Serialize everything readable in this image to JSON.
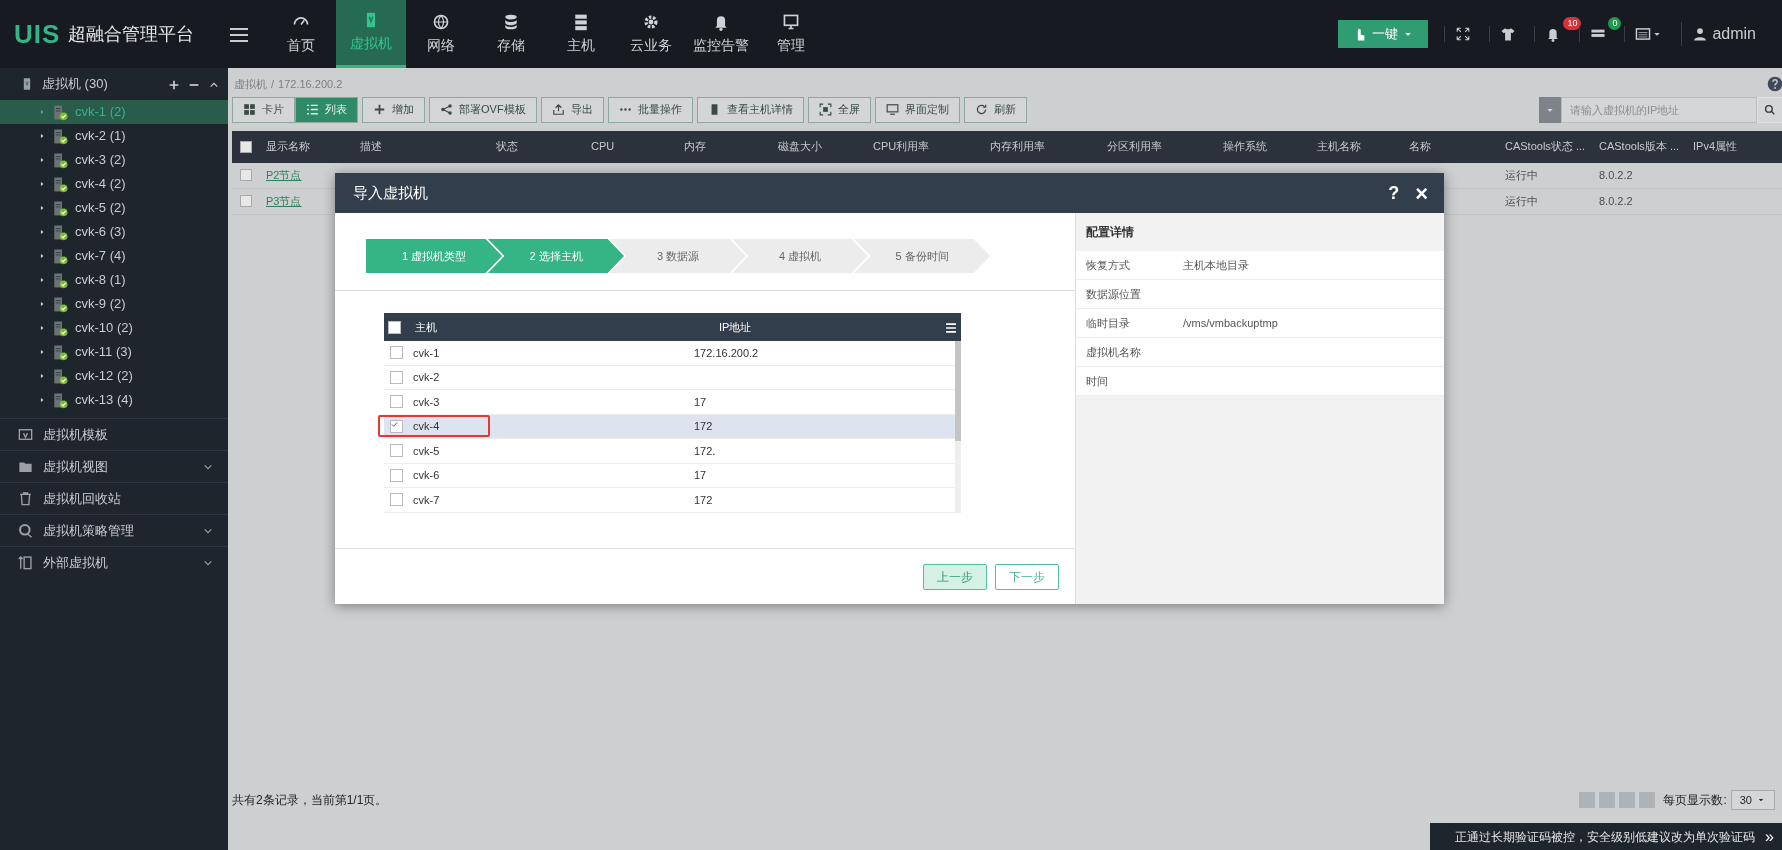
{
  "app": {
    "logo": "UIS",
    "title": "超融合管理平台"
  },
  "nav": [
    {
      "label": "首页",
      "selected": false
    },
    {
      "label": "虚拟机",
      "selected": true
    },
    {
      "label": "网络",
      "selected": false
    },
    {
      "label": "存储",
      "selected": false
    },
    {
      "label": "主机",
      "selected": false
    },
    {
      "label": "云业务",
      "selected": false
    },
    {
      "label": "监控告警",
      "selected": false
    },
    {
      "label": "管理",
      "selected": false
    }
  ],
  "topbar": {
    "quick_button": "一键",
    "alerts_count": "10",
    "tasks_count": "0",
    "user": "admin"
  },
  "sidebar": {
    "header": "虚拟机 (30)",
    "hosts": [
      {
        "label": "cvk-1 (2)",
        "selected": true
      },
      {
        "label": "cvk-2 (1)",
        "selected": false
      },
      {
        "label": "cvk-3 (2)",
        "selected": false
      },
      {
        "label": "cvk-4 (2)",
        "selected": false
      },
      {
        "label": "cvk-5 (2)",
        "selected": false
      },
      {
        "label": "cvk-6 (3)",
        "selected": false
      },
      {
        "label": "cvk-7 (4)",
        "selected": false
      },
      {
        "label": "cvk-8 (1)",
        "selected": false
      },
      {
        "label": "cvk-9 (2)",
        "selected": false
      },
      {
        "label": "cvk-10 (2)",
        "selected": false
      },
      {
        "label": "cvk-11 (3)",
        "selected": false
      },
      {
        "label": "cvk-12 (2)",
        "selected": false
      },
      {
        "label": "cvk-13 (4)",
        "selected": false
      }
    ],
    "sections": [
      {
        "label": "虚拟机模板",
        "expandable": false
      },
      {
        "label": "虚拟机视图",
        "expandable": true
      },
      {
        "label": "虚拟机回收站",
        "expandable": false
      },
      {
        "label": "虚拟机策略管理",
        "expandable": true
      },
      {
        "label": "外部虚拟机",
        "expandable": true
      }
    ]
  },
  "breadcrumb": {
    "items": [
      "虚拟机",
      "172.16.200.2"
    ],
    "separator": "/"
  },
  "view_toggle": [
    {
      "label": "卡片",
      "selected": false
    },
    {
      "label": "列表",
      "selected": true
    }
  ],
  "toolbar": [
    "增加",
    "部署OVF模板",
    "导出",
    "批量操作",
    "查看主机详情",
    "全屏",
    "界面定制",
    "刷新"
  ],
  "search": {
    "placeholder": "请输入虚拟机的IP地址"
  },
  "table": {
    "all_checked": false,
    "columns": [
      "显示名称",
      "描述",
      "状态",
      "CPU",
      "内存",
      "磁盘大小",
      "CPU利用率",
      "内存利用率",
      "分区利用率",
      "操作系统",
      "主机名称",
      "名称",
      "CAStools状态 ...",
      "CAStools版本 ...",
      "IPv4属性"
    ],
    "rows": [
      {
        "checked": false,
        "name": "P2节点",
        "castools_status": "运行中",
        "castools_version": "8.0.2.2"
      },
      {
        "checked": false,
        "name": "P3节点",
        "castools_status": "运行中",
        "castools_version": "8.0.2.2"
      }
    ]
  },
  "footer": {
    "summary": "共有2条记录，当前第1/1页。",
    "page_size_label": "每页显示数:",
    "page_size": "30"
  },
  "toast": {
    "text": "正通过长期验证码被控，安全级别低建议改为单次验证码",
    "arrow": "»"
  },
  "dialog": {
    "title": "导入虚拟机",
    "help": "?",
    "close": "×",
    "steps": [
      {
        "label": "1 虚拟机类型",
        "active": true
      },
      {
        "label": "2 选择主机",
        "active": true
      },
      {
        "label": "3 数据源",
        "active": false
      },
      {
        "label": "4 虚拟机",
        "active": false
      },
      {
        "label": "5 备份时间",
        "active": false
      }
    ],
    "all_checked": false,
    "host_columns": [
      "主机",
      "IP地址"
    ],
    "hosts": [
      {
        "name": "cvk-1",
        "ip": "172.16.200.2",
        "checked": false,
        "highlighted": false
      },
      {
        "name": "cvk-2",
        "checked": false,
        "highlighted": false
      },
      {
        "name": "cvk-3",
        "ip": "17",
        "checked": false,
        "highlighted": false
      },
      {
        "name": "cvk-4",
        "ip": "172",
        "checked": true,
        "highlighted": true
      },
      {
        "name": "cvk-5",
        "ip": "172.",
        "checked": false,
        "highlighted": false
      },
      {
        "name": "cvk-6",
        "ip": "17",
        "checked": false,
        "highlighted": false
      },
      {
        "name": "cvk-7",
        "ip": "172",
        "checked": false,
        "highlighted": false
      }
    ],
    "details_title": "配置详情",
    "details": [
      {
        "key": "恢复方式",
        "value": "主机本地目录"
      },
      {
        "key": "数据源位置"
      },
      {
        "key": "临时目录",
        "value": "/vms/vmbackuptmp"
      },
      {
        "key": "虚拟机名称"
      },
      {
        "key": "时间"
      }
    ],
    "buttons": [
      {
        "label": "上一步",
        "kind": "prev"
      },
      {
        "label": "下一步",
        "kind": "next"
      }
    ]
  }
}
